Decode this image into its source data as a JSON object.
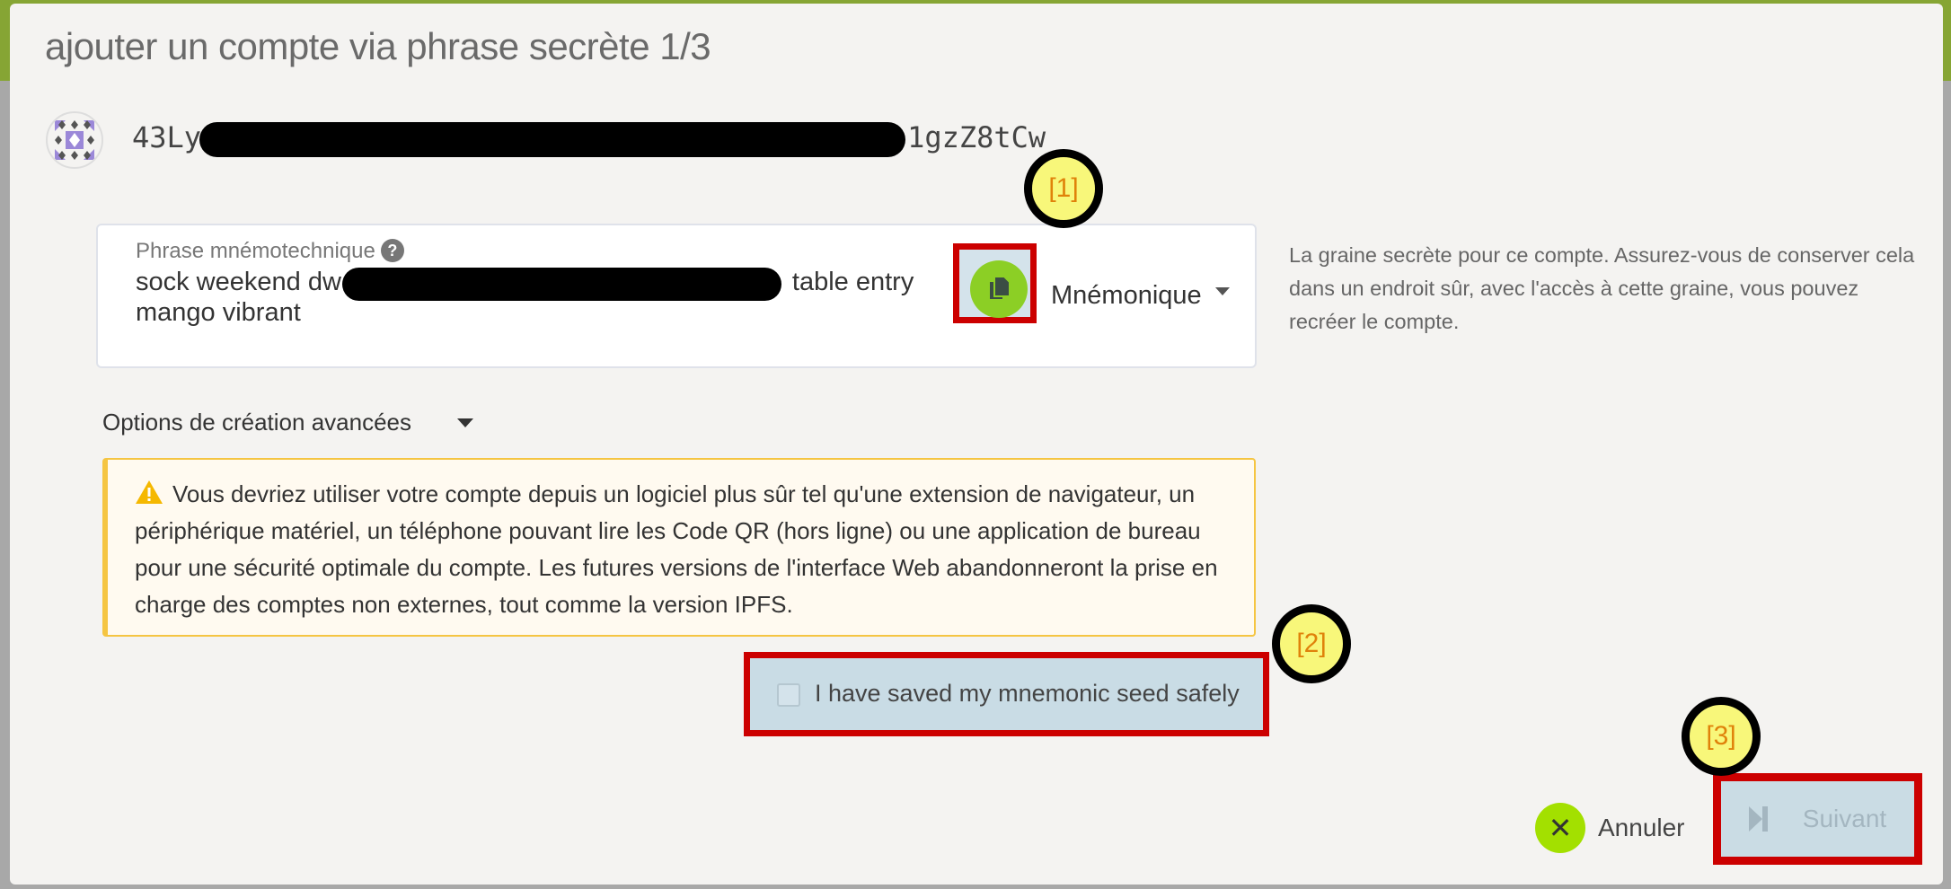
{
  "dialog": {
    "title": "ajouter un compte via phrase secrète 1/3",
    "address_prefix": "43Ly",
    "address_suffix": "1gzZ8tCw"
  },
  "mnemonic": {
    "label": "Phrase mnémotechnique",
    "help_icon": "question-circle-icon",
    "line1_start": "sock weekend dw",
    "line1_end": "table entry",
    "line2": "mango vibrant",
    "copy_icon": "copy-icon",
    "type_select": "Mnémonique",
    "help_text": "La graine secrète pour ce compte. Assurez-vous de conserver cela dans un endroit sûr, avec l'accès à cette graine, vous pouvez recréer le compte."
  },
  "advanced_options_label": "Options de création avancées",
  "warning": {
    "icon": "warning-triangle-icon",
    "text": "Vous devriez utiliser votre compte depuis un logiciel plus sûr tel qu'une extension de navigateur, un périphérique matériel, un téléphone pouvant lire les Code QR (hors ligne) ou une application de bureau pour une sécurité optimale du compte. Les futures versions de l'interface Web abandonneront la prise en charge des comptes non externes, tout comme la version IPFS."
  },
  "checkbox": {
    "label": "I have saved my mnemonic seed safely",
    "checked": false
  },
  "buttons": {
    "cancel": "Annuler",
    "next": "Suivant",
    "next_enabled": false
  },
  "markers": [
    "[1]",
    "[2]",
    "[3]"
  ],
  "colors": {
    "accent_green": "#8ccf25",
    "highlight_red": "#cc0000",
    "warning_border": "#f5c542"
  }
}
